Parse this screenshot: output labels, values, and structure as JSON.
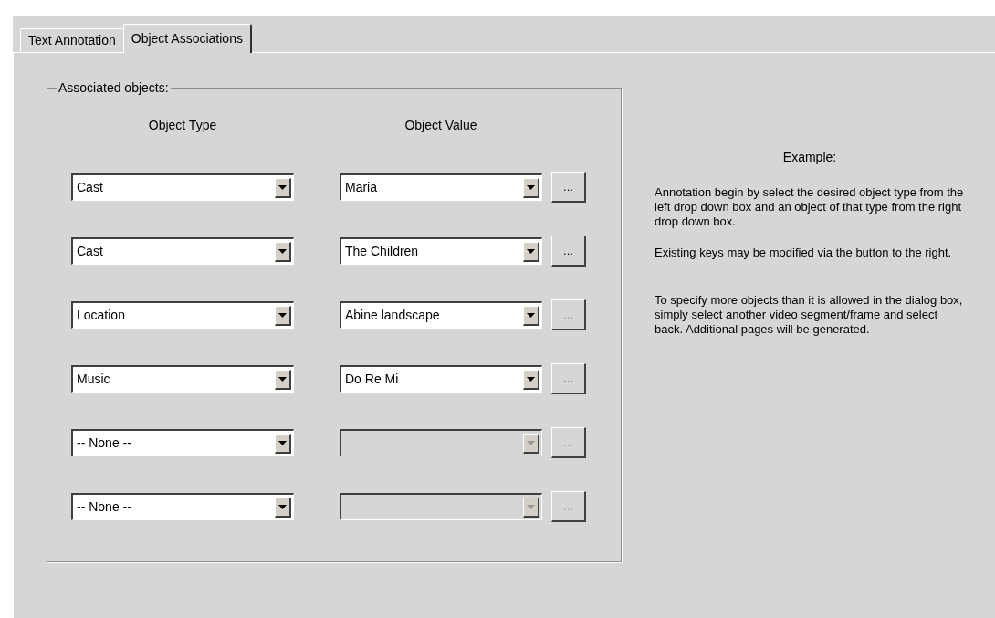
{
  "tabs": [
    {
      "label": "Text Annotation",
      "selected": false
    },
    {
      "label": "Object Associations",
      "selected": true
    }
  ],
  "group": {
    "title": "Associated objects:",
    "columns": [
      "Object Type",
      "Object Value"
    ],
    "rows": [
      {
        "type": "Cast",
        "value": "Maria",
        "value_disabled": false,
        "button": "...",
        "button_disabled": false
      },
      {
        "type": "Cast",
        "value": "The Children",
        "value_disabled": false,
        "button": "...",
        "button_disabled": false
      },
      {
        "type": "Location",
        "value": "Abine landscape",
        "value_disabled": false,
        "button": "...",
        "button_disabled": true
      },
      {
        "type": "Music",
        "value": "Do Re Mi",
        "value_disabled": false,
        "button": "...",
        "button_disabled": false
      },
      {
        "type": "-- None --",
        "value_disabled": true,
        "button": "...",
        "button_disabled": true
      },
      {
        "type": "-- None --",
        "value_disabled": true,
        "button": "...",
        "button_disabled": true
      }
    ]
  },
  "example": {
    "title": "Example:",
    "paragraphs": [
      "Annotation begin by select the desired object type from the left drop down box and an object of that type from the right drop down box.",
      "Existing keys may be modified via the button to the right.",
      "To specify more objects than it is allowed in the dialog box, simply select another video segment/frame and select back. Additional pages will be generated."
    ]
  }
}
